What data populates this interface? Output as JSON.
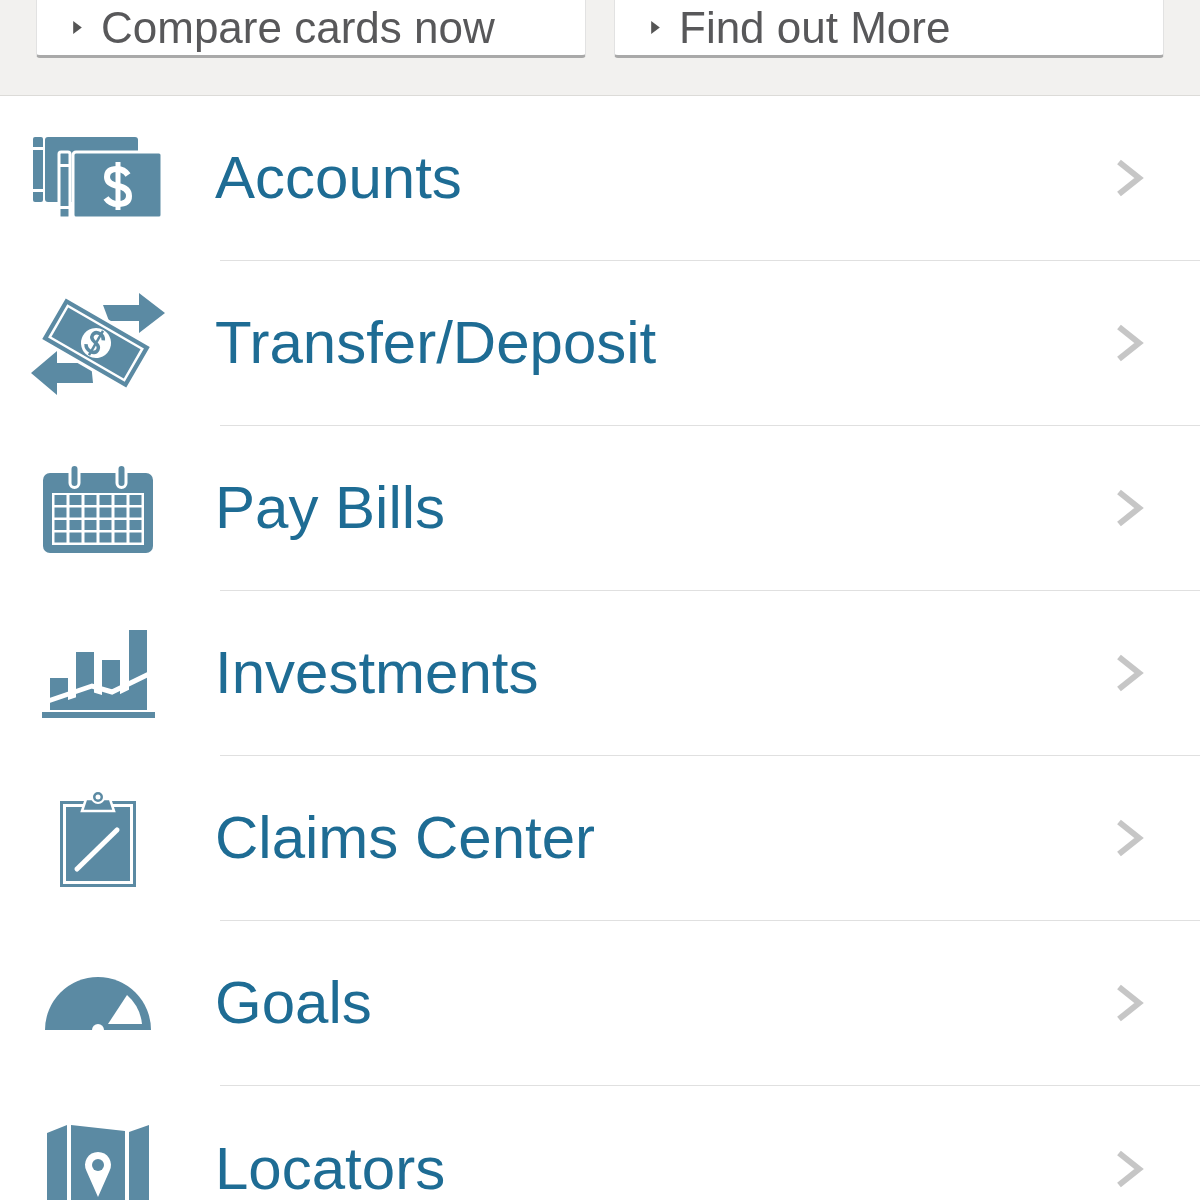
{
  "promo_buttons": [
    {
      "label": "Compare cards now"
    },
    {
      "label": "Find out More"
    }
  ],
  "menu": {
    "items": [
      {
        "label": "Accounts"
      },
      {
        "label": "Transfer/Deposit"
      },
      {
        "label": "Pay Bills"
      },
      {
        "label": "Investments"
      },
      {
        "label": "Claims Center"
      },
      {
        "label": "Goals"
      },
      {
        "label": "Locators"
      }
    ]
  }
}
